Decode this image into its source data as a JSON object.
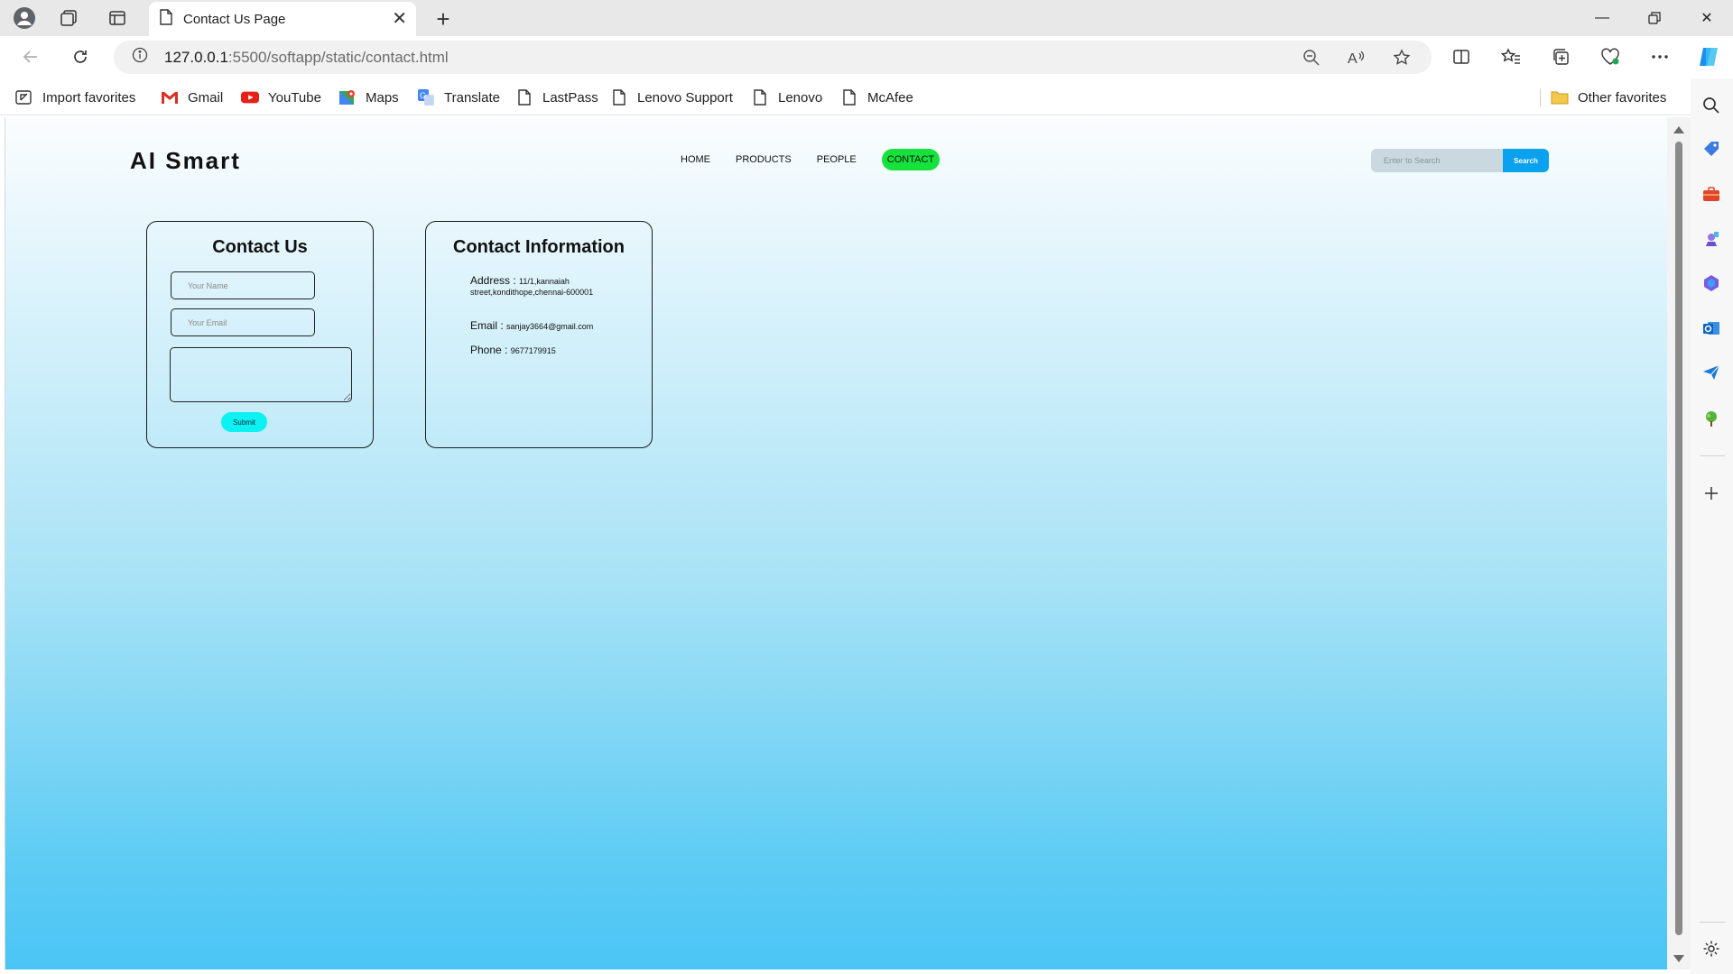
{
  "browser": {
    "tab_title": "Contact Us Page",
    "url_host": "127.0.0.1",
    "url_path": ":5500/softapp/static/contact.html",
    "bookmarks": [
      {
        "label": "Import favorites",
        "icon": "import-icon"
      },
      {
        "label": "Gmail",
        "icon": "gmail-icon"
      },
      {
        "label": "YouTube",
        "icon": "youtube-icon"
      },
      {
        "label": "Maps",
        "icon": "maps-icon"
      },
      {
        "label": "Translate",
        "icon": "translate-icon"
      },
      {
        "label": "LastPass",
        "icon": "page-icon"
      },
      {
        "label": "Lenovo Support",
        "icon": "page-icon"
      },
      {
        "label": "Lenovo",
        "icon": "page-icon"
      },
      {
        "label": "McAfee",
        "icon": "page-icon"
      }
    ],
    "other_favorites": "Other favorites"
  },
  "site": {
    "logo": "AI Smart",
    "nav": [
      "HOME",
      "PRODUCTS",
      "PEOPLE",
      "CONTACT"
    ],
    "active_nav": "CONTACT",
    "search_placeholder": "Enter to Search",
    "search_button": "Search"
  },
  "contact_form": {
    "title": "Contact Us",
    "name_placeholder": "Your Name",
    "email_placeholder": "Your Email",
    "message_value": "",
    "submit_label": "Submit"
  },
  "contact_info": {
    "title": "Contact Information",
    "address_label": "Address :",
    "address_value": "11/1,kannaiah street,kondithope,chennai-600001",
    "email_label": "Email :",
    "email_value": "sanjay3664@gmail.com",
    "phone_label": "Phone :",
    "phone_value": "9677179915"
  },
  "colors": {
    "active_nav_bg": "#16e23c",
    "search_button_bg": "#0aa1ee",
    "submit_bg": "#0cf2f2",
    "page_gradient_bottom": "#4bc5f5"
  }
}
